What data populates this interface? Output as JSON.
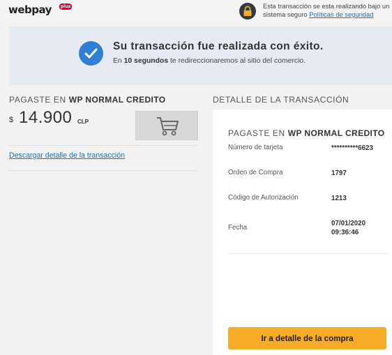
{
  "header": {
    "logo_text": "webpay",
    "logo_plus": "plus",
    "security_text": "Esta transacción se esta realizando bajo un sistema seguro",
    "security_link": "Políticas de seguridad"
  },
  "banner": {
    "title": "Su transacción fue realizada con éxito.",
    "sub_prefix": "En",
    "sub_bold": "10 segundos",
    "sub_suffix": "te redireccionaremos al sitio del comercio."
  },
  "payment": {
    "title_prefix": "PAGASTE EN",
    "title_bold": "WP NORMAL CREDITO",
    "currency_symbol": "$",
    "amount": "14.900",
    "currency_code": "CLP",
    "download_link": "Descargar detalle de la transacción"
  },
  "detail": {
    "section_title": "DETALLE DE LA TRANSACCIÓN",
    "card_title_prefix": "PAGASTE EN",
    "card_title_bold": "WP NORMAL CREDITO",
    "rows": [
      {
        "label": "Número de tarjeta",
        "value": "**********6623"
      },
      {
        "label": "Orden de Compra",
        "value": "1797"
      },
      {
        "label": "Código de Autorización",
        "value": "1213"
      },
      {
        "label": "Fecha",
        "value_line1": "07/01/2020",
        "value_line2": "09:36:46"
      }
    ],
    "cta_label": "Ir a detalle de la compra"
  },
  "colors": {
    "accent_blue": "#2f7fd6",
    "cta_orange": "#f6ac27",
    "link_blue": "#1b6fb5",
    "brand_red": "#e4002b"
  },
  "icons": [
    "lock-icon",
    "check-circle-icon",
    "cart-icon"
  ]
}
